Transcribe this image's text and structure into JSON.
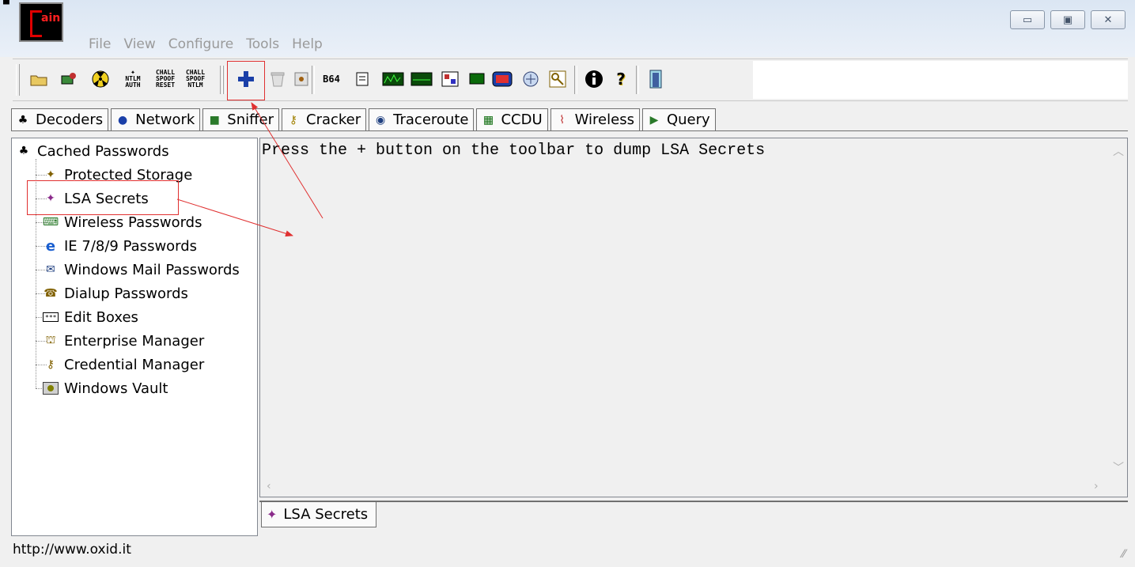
{
  "app": {
    "logo_text": "ain",
    "sysmenu_glyph": "▀"
  },
  "menu": [
    "File",
    "View",
    "Configure",
    "Tools",
    "Help"
  ],
  "window_buttons": {
    "minimize": "▭",
    "restore": "▣",
    "close": "✕"
  },
  "toolbar_small": {
    "ntlm_auth": [
      "NTLM",
      "AUTH"
    ],
    "chall_spoof_reset": [
      "CHALL",
      "SPOOF",
      "RESET"
    ],
    "chall_spoof_ntlm": [
      "CHALL",
      "SPOOF",
      "NTLM"
    ],
    "b64": "B64"
  },
  "tabs": [
    {
      "label": "Decoders",
      "icon": "decoders-icon"
    },
    {
      "label": "Network",
      "icon": "network-icon"
    },
    {
      "label": "Sniffer",
      "icon": "sniffer-icon"
    },
    {
      "label": "Cracker",
      "icon": "cracker-icon"
    },
    {
      "label": "Traceroute",
      "icon": "traceroute-icon"
    },
    {
      "label": "CCDU",
      "icon": "ccdu-icon"
    },
    {
      "label": "Wireless",
      "icon": "wireless-icon"
    },
    {
      "label": "Query",
      "icon": "query-icon"
    }
  ],
  "tree": {
    "root": "Cached Passwords",
    "children": [
      "Protected Storage",
      "LSA Secrets",
      "Wireless Passwords",
      "IE 7/8/9 Passwords",
      "Windows Mail Passwords",
      "Dialup Passwords",
      "Edit Boxes",
      "Enterprise Manager",
      "Credential Manager",
      "Windows Vault"
    ]
  },
  "content": {
    "message": "Press the + button on the toolbar to dump LSA Secrets"
  },
  "subtab": {
    "label": "LSA Secrets"
  },
  "status": {
    "text": "http://www.oxid.it"
  },
  "colors": {
    "annotation": "#e03030",
    "add_button": "#1a3fa8"
  }
}
